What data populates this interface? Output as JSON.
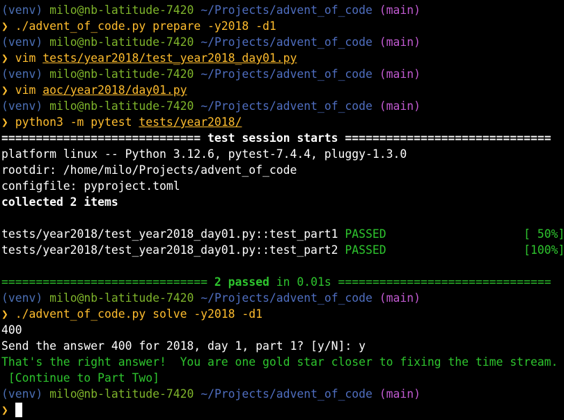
{
  "prompt": {
    "venv": "(venv)",
    "user_host": "milo@nb-latitude-7420",
    "path": "~/Projects/advent_of_code",
    "branch": "(main)",
    "chevron": "❯"
  },
  "commands": {
    "c1": "./advent_of_code.py prepare -y2018 -d1",
    "c2_cmd": "vim ",
    "c2_arg": "tests/year2018/test_year2018_day01.py",
    "c3_cmd": "vim ",
    "c3_arg": "aoc/year2018/day01.py",
    "c4_cmd": "python3 -m pytest ",
    "c4_arg": "tests/year2018/",
    "c5": "./advent_of_code.py solve -y2018 -d1"
  },
  "pytest": {
    "rule_left": "============================= ",
    "header": "test session starts",
    "rule_right": " ==============================",
    "platform": "platform linux -- Python 3.12.6, pytest-7.4.4, pluggy-1.3.0",
    "rootdir": "rootdir: /home/milo/Projects/advent_of_code",
    "configfile": "configfile: pyproject.toml",
    "collected": "collected 2 items",
    "tests": [
      {
        "name": "tests/year2018/test_year2018_day01.py::test_part1 ",
        "status": "PASSED",
        "progress": "[ 50%]",
        "pad": "                    "
      },
      {
        "name": "tests/year2018/test_year2018_day01.py::test_part2 ",
        "status": "PASSED",
        "progress": "[100%]",
        "pad": "                    "
      }
    ],
    "summary_rule_left": "============================== ",
    "summary_passed": "2 passed",
    "summary_time": " in 0.01s",
    "summary_rule_right": " ==============================="
  },
  "solve": {
    "answer": "400",
    "send_prompt": "Send the answer 400 for 2018, day 1, part 1? [y/N]: y",
    "response": "That's the right answer!  You are one gold star closer to fixing the time stream.",
    "continue": " [Continue to Part Two]"
  }
}
